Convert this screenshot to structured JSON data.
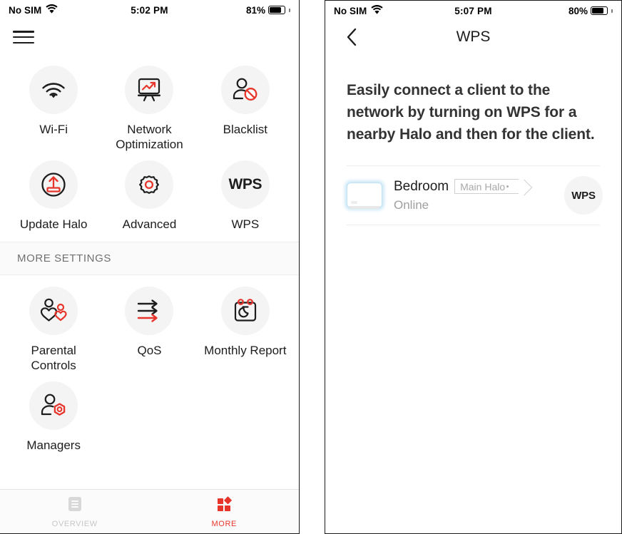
{
  "left_phone": {
    "status_bar": {
      "carrier": "No SIM",
      "wifi_icon": "wifi-icon",
      "time": "5:02 PM",
      "battery_percent": "81%",
      "battery_level": 81
    },
    "menu_button_icon": "hamburger-menu-icon",
    "main_grid": [
      {
        "label": "Wi-Fi",
        "icon": "wifi-icon"
      },
      {
        "label": "Network Optimization",
        "icon": "network-optimization-chart-icon"
      },
      {
        "label": "Blacklist",
        "icon": "user-blocked-icon"
      },
      {
        "label": "Update Halo",
        "icon": "upload-update-icon"
      },
      {
        "label": "Advanced",
        "icon": "gear-icon"
      },
      {
        "label": "WPS",
        "icon": "wps-text-icon",
        "icon_text": "WPS"
      }
    ],
    "section_header": "MORE SETTINGS",
    "more_grid": [
      {
        "label": "Parental Controls",
        "icon": "parent-child-heart-icon"
      },
      {
        "label": "QoS",
        "icon": "arrows-priority-icon"
      },
      {
        "label": "Monthly Report",
        "icon": "calendar-moon-icon"
      },
      {
        "label": "Managers",
        "icon": "user-hexagon-gear-icon"
      }
    ],
    "tab_bar": [
      {
        "label": "OVERVIEW",
        "icon": "list-overview-icon",
        "active": false
      },
      {
        "label": "MORE",
        "icon": "grid-squares-icon",
        "active": true
      }
    ]
  },
  "right_phone": {
    "status_bar": {
      "carrier": "No SIM",
      "wifi_icon": "wifi-icon",
      "time": "5:07 PM",
      "battery_percent": "80%",
      "battery_level": 80
    },
    "nav": {
      "back_icon": "chevron-left-icon",
      "title": "WPS"
    },
    "intro_text": "Easily connect a client to the network by turning on WPS for a nearby Halo and then for the client.",
    "device": {
      "thumbnail_icon": "halo-device-icon",
      "name": "Bedroom",
      "tag": "Main Halo",
      "status": "Online",
      "action_label": "WPS"
    }
  },
  "colors": {
    "accent_red": "#e8352c",
    "text_primary": "#1d1d1d",
    "text_muted": "#a0a0a0",
    "icon_bg": "#f4f4f4",
    "section_bg": "#fafafa"
  }
}
